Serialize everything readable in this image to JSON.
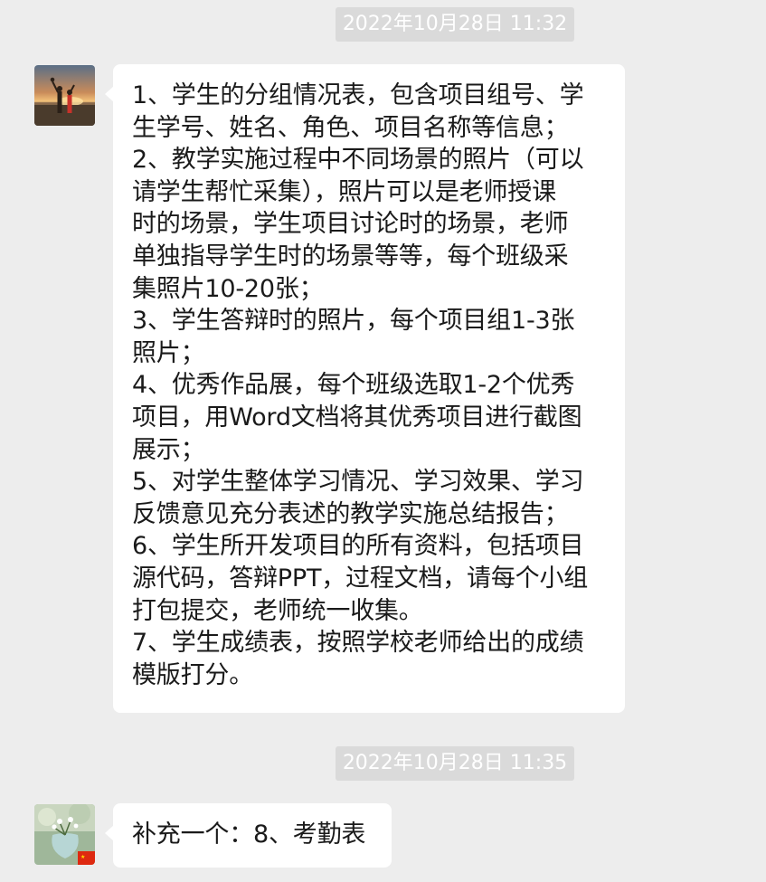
{
  "messages": [
    {
      "timestamp": "2022年10月28日 11:32",
      "avatar": "sunset-family-avatar",
      "lines": [
        "1、学生的分组情况表，包含项目组号、学",
        "生学号、姓名、角色、项目名称等信息；",
        "2、教学实施过程中不同场景的照片（可以",
        "请学生帮忙采集），照片可以是老师授课",
        "时的场景，学生项目讨论时的场景，老师",
        "单独指导学生时的场景等等，每个班级采",
        "集照片10-20张；",
        "3、学生答辩时的照片，每个项目组1-3张",
        "照片；",
        "4、优秀作品展，每个班级选取1-2个优秀",
        "项目，用Word文档将其优秀项目进行截图",
        "展示；",
        "5、对学生整体学习情况、学习效果、学习",
        "反馈意见充分表述的教学实施总结报告；",
        "6、学生所开发项目的所有资料，包括项目",
        "源代码，答辩PPT，过程文档，请每个小组",
        "打包提交，老师统一收集。",
        "7、学生成绩表，按照学校老师给出的成绩",
        "模版打分。"
      ]
    },
    {
      "timestamp": "2022年10月28日 11:35",
      "avatar": "flower-vase-avatar",
      "text": "补充一个：8、考勤表"
    }
  ],
  "colors": {
    "background": "#ededed",
    "bubble": "#ffffff",
    "timestamp_bg": "#dadada",
    "text": "#1a1a1a"
  }
}
